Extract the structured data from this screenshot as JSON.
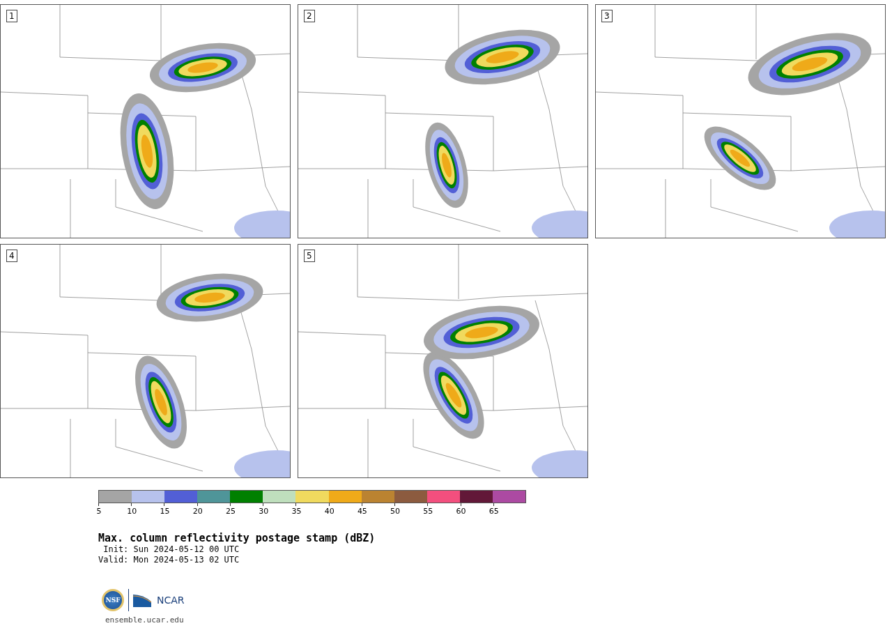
{
  "panels": [
    {
      "label": "1"
    },
    {
      "label": "2"
    },
    {
      "label": "3"
    },
    {
      "label": "4"
    },
    {
      "label": "5"
    }
  ],
  "colorbar": {
    "bins": [
      {
        "color": "#a5a5a5"
      },
      {
        "color": "#b7c2ed"
      },
      {
        "color": "#525fd6"
      },
      {
        "color": "#4f9599"
      },
      {
        "color": "#008000"
      },
      {
        "color": "#bfdfbd"
      },
      {
        "color": "#f0da5e"
      },
      {
        "color": "#efaa19"
      },
      {
        "color": "#bb8331"
      },
      {
        "color": "#8c5b3f"
      },
      {
        "color": "#f34f7e"
      },
      {
        "color": "#621838"
      },
      {
        "color": "#ac4aa2"
      }
    ],
    "ticks": [
      "5",
      "10",
      "15",
      "20",
      "25",
      "30",
      "35",
      "40",
      "45",
      "50",
      "55",
      "60",
      "65"
    ]
  },
  "title": "Max. column reflectivity postage stamp (dBZ)",
  "init": " Init: Sun 2024-05-12 00 UTC",
  "valid": "Valid: Mon 2024-05-13 02 UTC",
  "logos": {
    "nsf": "NSF",
    "ncar": "NCAR"
  },
  "footer": "ensemble.ucar.edu"
}
